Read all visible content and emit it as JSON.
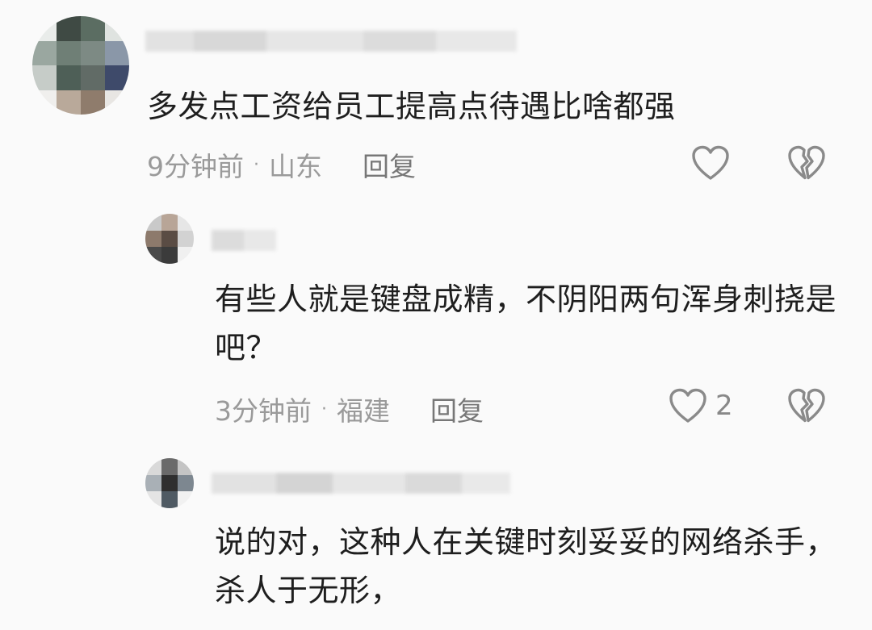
{
  "comments": [
    {
      "text": "多发点工资给员工提高点待遇比啥都强",
      "time": "9分钟前",
      "separator": "·",
      "location": "山东",
      "reply_label": "回复",
      "likes": ""
    },
    {
      "text": "有些人就是键盘成精，不阴阳两句浑身刺挠是吧？",
      "time": "3分钟前",
      "separator": "·",
      "location": "福建",
      "reply_label": "回复",
      "likes": "2"
    },
    {
      "text": "说的对，这种人在关键时刻妥妥的网络杀手，杀人于无形，"
    }
  ],
  "icons": {
    "like": "heart-outline-icon",
    "dislike": "broken-heart-icon"
  },
  "colors": {
    "background": "#fafafa",
    "text": "#1e1e1e",
    "meta": "#9a9a9a",
    "icon": "#8a8a8a"
  }
}
